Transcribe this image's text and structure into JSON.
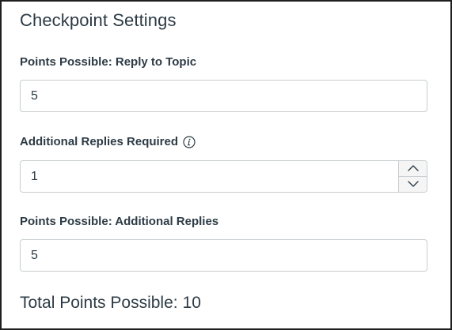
{
  "checkpoint": {
    "title": "Checkpoint Settings",
    "fields": [
      {
        "label": "Points Possible: Reply to Topic",
        "value": "5"
      },
      {
        "label": "Additional Replies Required",
        "value": "1",
        "info_icon": "info-circle-icon",
        "stepper_icons": [
          "chevron-up-icon",
          "chevron-down-icon"
        ]
      },
      {
        "label": "Points Possible: Additional Replies",
        "value": "5"
      }
    ],
    "total": {
      "label": "Total Points Possible:",
      "value": "10"
    }
  }
}
